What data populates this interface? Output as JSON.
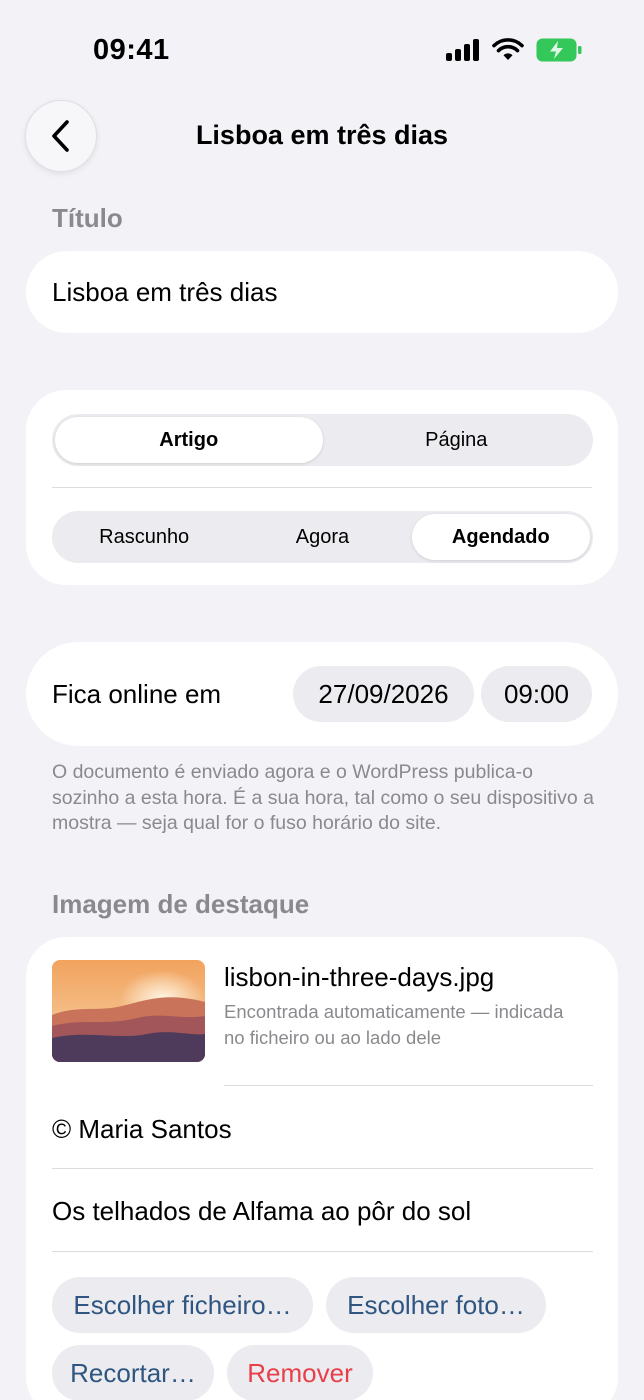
{
  "status_bar": {
    "time": "09:41",
    "battery_color": "#34c759"
  },
  "nav": {
    "title": "Lisboa em três dias"
  },
  "title_section": {
    "label": "Título",
    "value": "Lisboa em três dias"
  },
  "type_segment": {
    "options": [
      "Artigo",
      "Página"
    ],
    "selected": "Artigo"
  },
  "publish_segment": {
    "options": [
      "Rascunho",
      "Agora",
      "Agendado"
    ],
    "selected": "Agendado"
  },
  "schedule": {
    "label": "Fica online em",
    "date": "27/09/2026",
    "time": "09:00",
    "footnote": "O documento é enviado agora e o WordPress publica-o sozinho a esta hora. É a sua hora, tal como o seu dispositivo a mostra — seja qual for o fuso horário do site."
  },
  "featured_image": {
    "label": "Imagem de destaque",
    "file_name": "lisbon-in-three-days.jpg",
    "file_note": "Encontrada automaticamente — indicada no ficheiro ou ao lado dele",
    "credit": "© Maria Santos",
    "caption": "Os telhados de Alfama ao pôr do sol",
    "actions": {
      "choose_file": "Escolher ficheiro…",
      "choose_photo": "Escolher foto…",
      "crop": "Recortar…",
      "remove": "Remover"
    }
  },
  "colors": {
    "background": "#f2f2f7",
    "accent": "#2f5680",
    "destructive": "#e8404a",
    "secondary_text": "#8a8a8e"
  }
}
